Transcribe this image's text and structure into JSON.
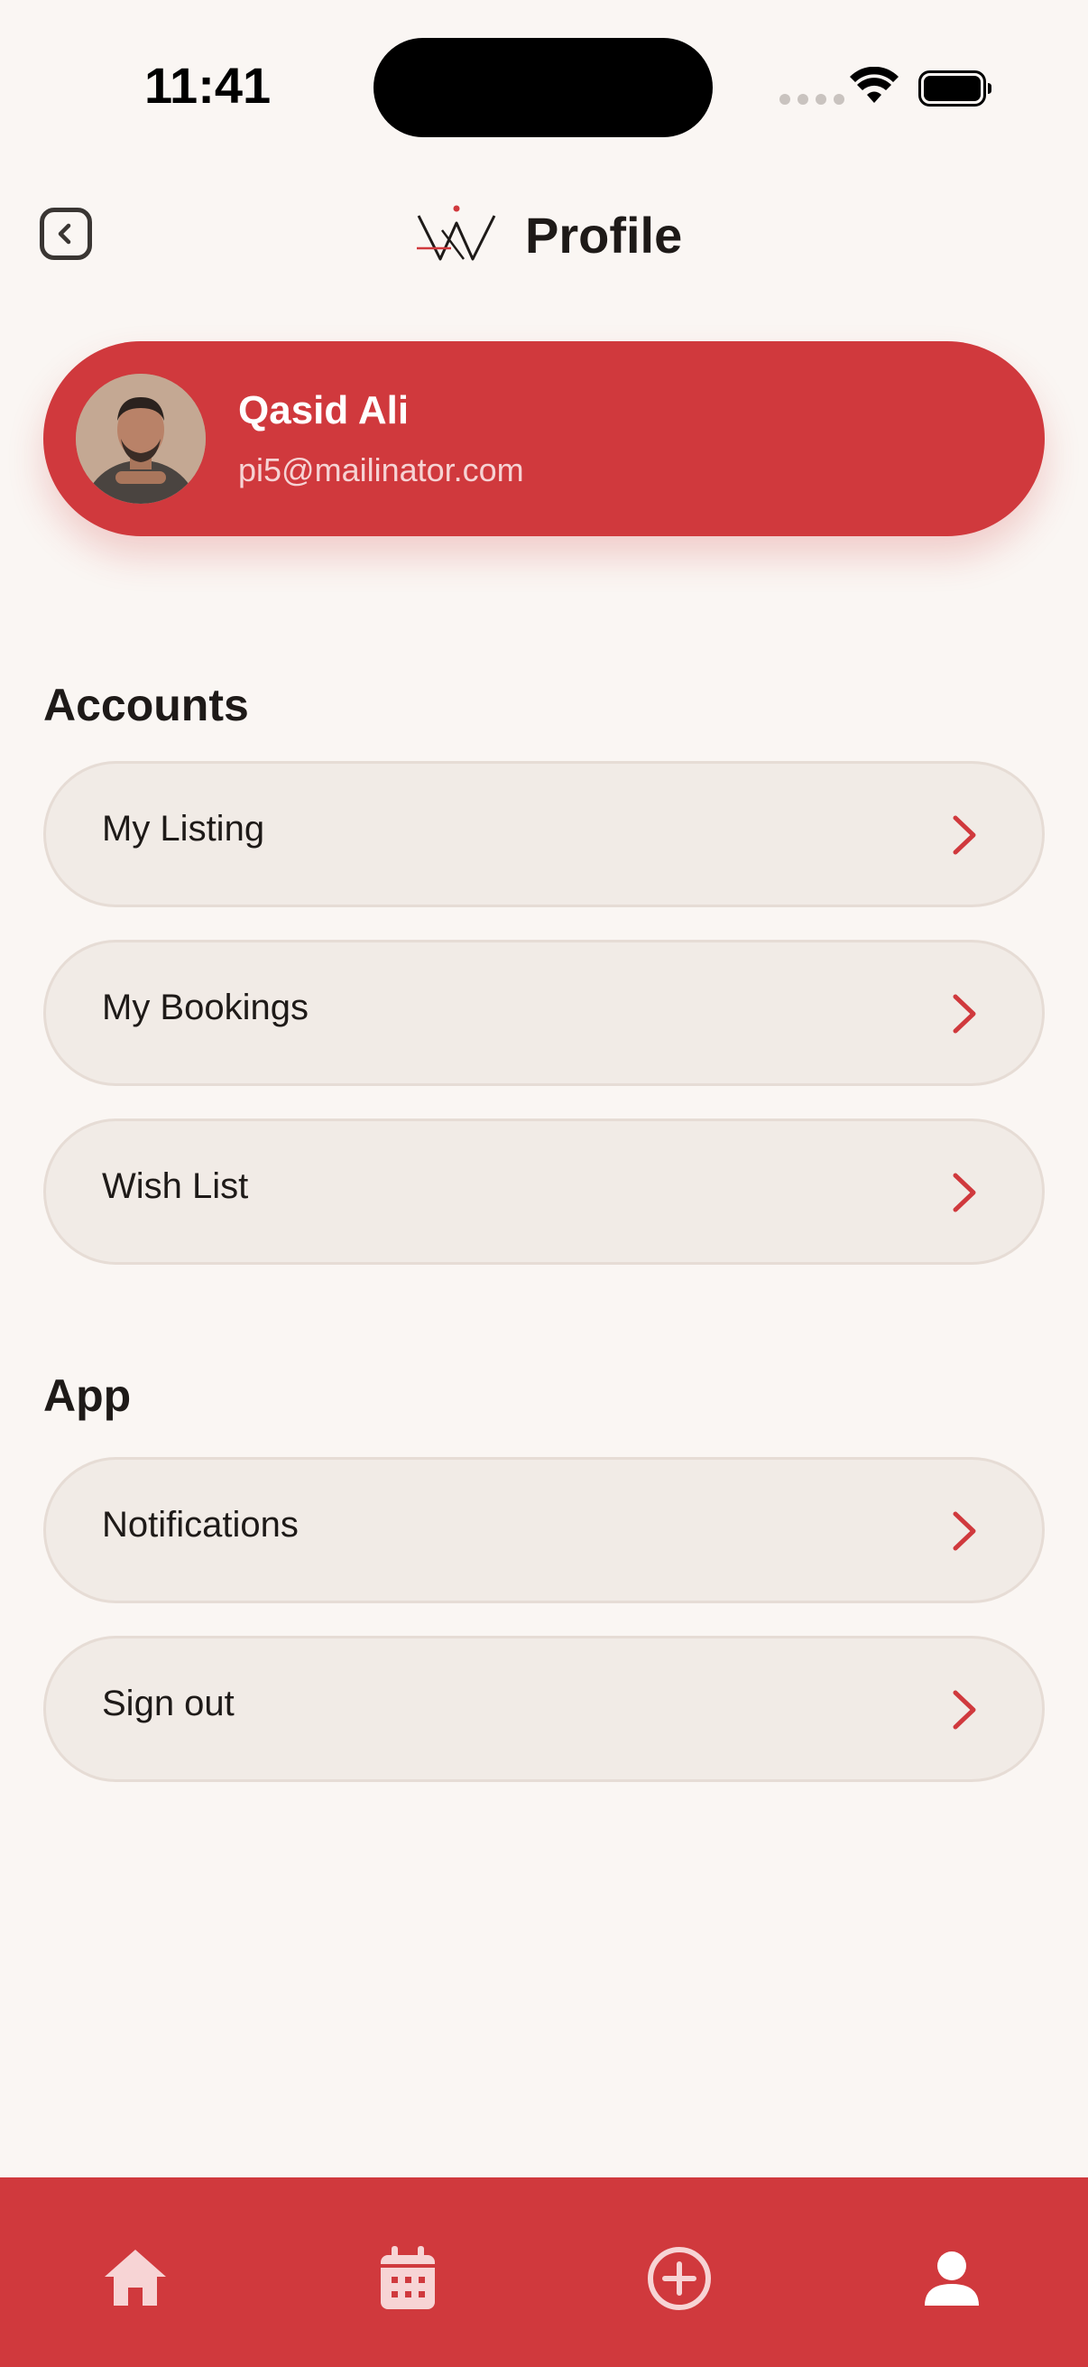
{
  "status_bar": {
    "time": "11:41"
  },
  "header": {
    "title": "Profile"
  },
  "profile": {
    "name": "Qasid Ali",
    "email": "pi5@mailinator.com"
  },
  "sections": {
    "accounts": {
      "title": "Accounts",
      "items": [
        {
          "label": "My Listing"
        },
        {
          "label": "My Bookings"
        },
        {
          "label": "Wish List"
        }
      ]
    },
    "app": {
      "title": "App",
      "items": [
        {
          "label": "Notifications"
        },
        {
          "label": "Sign out"
        }
      ]
    }
  },
  "bottom_nav": {
    "items": [
      {
        "icon": "home-icon"
      },
      {
        "icon": "calendar-icon"
      },
      {
        "icon": "add-circle-icon"
      },
      {
        "icon": "profile-icon"
      }
    ]
  },
  "colors": {
    "accent": "#d0393d",
    "background": "#faf6f3",
    "menu_item_bg": "#f1ebe6",
    "nav_icon": "#f7d4d5"
  }
}
